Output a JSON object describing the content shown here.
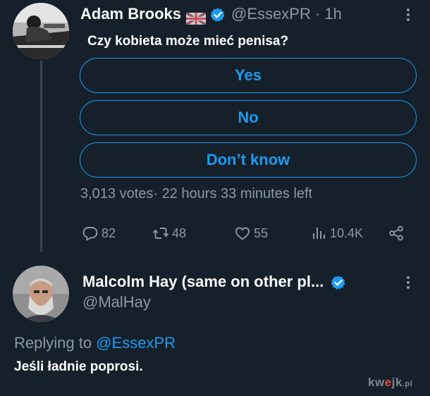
{
  "tweet": {
    "author_name": "Adam Brooks",
    "handle_time": "@EssexPR · 1h",
    "text": "Czy kobieta może mieć penisa?",
    "poll": {
      "options": [
        "Yes",
        "No",
        "Don’t know"
      ],
      "meta": "3,013 votes· 22 hours 33 minutes left"
    },
    "actions": {
      "replies": "82",
      "retweets": "48",
      "likes": "55",
      "views": "10.4K"
    },
    "icons": [
      "uk-flag-icon",
      "verified-badge-icon",
      "more-icon",
      "reply-icon",
      "retweet-icon",
      "like-icon",
      "views-icon",
      "share-icon"
    ]
  },
  "reply": {
    "author_name": "Malcolm Hay (same on other pl...",
    "handle": "@MalHay",
    "replying_prefix": "Replying to ",
    "replying_mention": "@EssexPR",
    "text": "Jeśli ładnie poprosi."
  },
  "watermark": {
    "part1": "kw",
    "part2": "e",
    "part3": "jk",
    "part4": ".pl"
  },
  "colors": {
    "background": "#15202b",
    "accent": "#1d9bf0",
    "muted": "#8b98a5",
    "text": "#f7f9f9"
  }
}
